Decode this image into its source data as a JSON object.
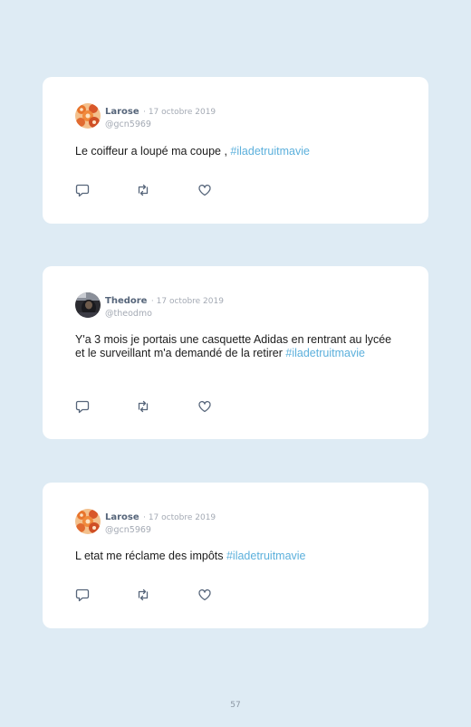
{
  "tweets": [
    {
      "name": "Larose",
      "date": "· 17 octobre 2019",
      "handle": "@gcn5969",
      "avatar": "orange-pattern-avatar",
      "text": "Le coiffeur a loupé ma coupe , ",
      "hashtag": "#iladetruitmavie"
    },
    {
      "name": "Thedore",
      "date": "· 17 octobre 2019",
      "handle": "@theodmo",
      "avatar": "dark-photo-avatar",
      "text": "Y'a 3 mois je portais une casquette Adidas en rentrant au lycée et le surveillant m'a demandé de la retirer",
      "hashtag": "#iladetruitmavie"
    },
    {
      "name": "Larose",
      "date": "· 17 octobre 2019",
      "handle": "@gcn5969",
      "avatar": "orange-pattern-avatar",
      "text": "L etat me réclame des impôts ",
      "hashtag": "#iladetruitmavie"
    }
  ],
  "actions": {
    "reply_icon": "reply-icon",
    "retweet_icon": "retweet-icon",
    "like_icon": "heart-icon"
  },
  "colors": {
    "background": "#deebf4",
    "card": "#ffffff",
    "hashtag": "#5cb0dc",
    "name": "#56657a",
    "meta": "#a4aab4"
  },
  "page_number": "57"
}
